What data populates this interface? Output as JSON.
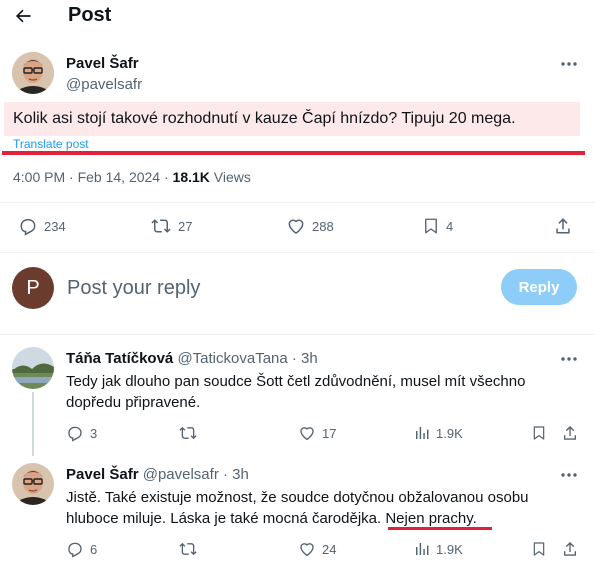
{
  "header": {
    "title": "Post"
  },
  "post": {
    "author_name": "Pavel Šafr",
    "author_handle": "@pavelsafr",
    "text": "Kolik asi stojí takové rozhodnutí v kauze Čapí hnízdo? Tipuju 20 mega.",
    "translate_label": "Translate post",
    "timestamp": "4:00 PM · Feb 14, 2024 · ",
    "views_count": "18.1K",
    "views_label": " Views",
    "replies": "234",
    "reposts": "27",
    "likes": "288",
    "bookmarks": "4"
  },
  "composer": {
    "avatar_letter": "P",
    "placeholder": "Post your reply",
    "reply_button": "Reply"
  },
  "replies": [
    {
      "author_name": "Táňa Tatíčková",
      "author_handle": "@TatickovaTana",
      "time": "· 3h",
      "text": "Tedy jak dlouho  pan soudce Šott četl zdůvodnění, musel mít všechno dopředu připravené.",
      "replies": "3",
      "reposts": "",
      "likes": "17",
      "views": "1.9K"
    },
    {
      "author_name": "Pavel Šafr",
      "author_handle": "@pavelsafr",
      "time": "· 3h",
      "text": "Jistě. Také existuje možnost, že soudce dotyčnou obžalovanou osobu hluboce miluje. Láska je také mocná čarodějka. Nejen prachy.",
      "replies": "6",
      "reposts": "",
      "likes": "24",
      "views": "1.9K"
    }
  ],
  "colors": {
    "accent": "#1d9bf0",
    "highlight": "#fde8ea",
    "annotation_red": "#e0213a",
    "composer_avatar": "#6b3b2e"
  }
}
